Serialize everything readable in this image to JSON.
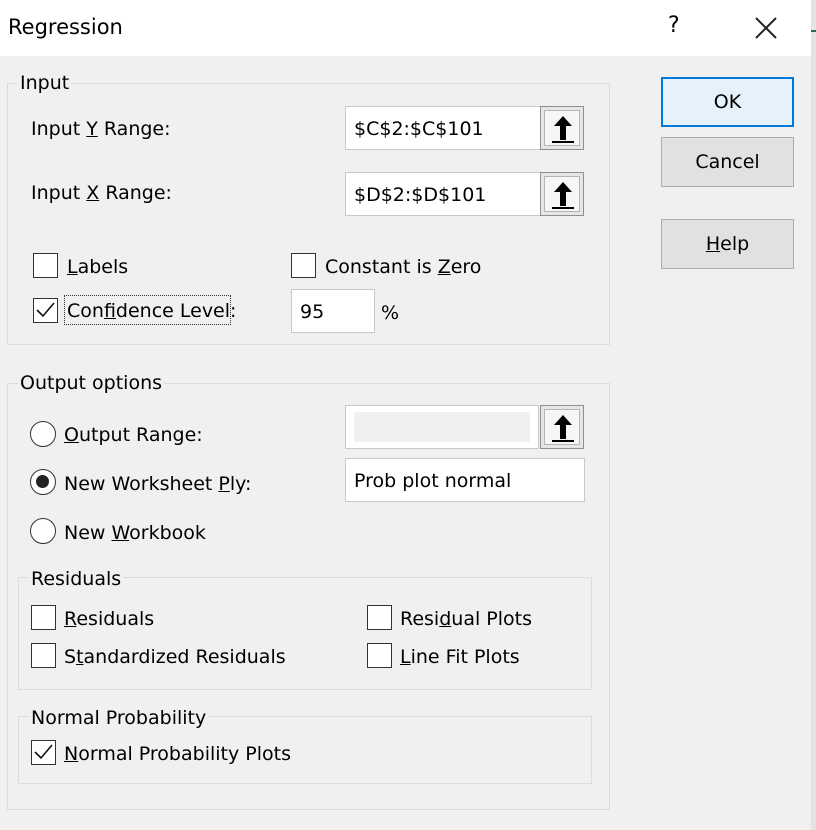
{
  "window": {
    "title": "Regression",
    "help_glyph": "?",
    "close_icon": "close-icon"
  },
  "input": {
    "group_label": "Input",
    "y_range": {
      "label_pre": "Input ",
      "label_key": "Y",
      "label_post": " Range:",
      "value": "$C$2:$C$101"
    },
    "x_range": {
      "label_pre": "Input ",
      "label_key": "X",
      "label_post": " Range:",
      "value": "$D$2:$D$101"
    },
    "labels": {
      "label_key": "L",
      "label_post": "abels",
      "checked": false
    },
    "constant_zero": {
      "label_pre": "Constant is ",
      "label_key": "Z",
      "label_post": "ero",
      "checked": false
    },
    "confidence": {
      "label_pre": "Con",
      "label_key": "f",
      "label_post": "idence Level:",
      "checked": true,
      "value": "95",
      "unit": "%"
    }
  },
  "output": {
    "group_label": "Output options",
    "output_range": {
      "label_key": "O",
      "label_post": "utput Range:",
      "selected": false,
      "value": ""
    },
    "new_ply": {
      "label_pre": "New Worksheet ",
      "label_key": "P",
      "label_post": "ly:",
      "selected": true,
      "value": "Prob plot normal"
    },
    "new_workbook": {
      "label_pre": "New ",
      "label_key": "W",
      "label_post": "orkbook",
      "selected": false
    }
  },
  "residuals": {
    "group_label": "Residuals",
    "residuals": {
      "label_key": "R",
      "label_post": "esiduals",
      "checked": false
    },
    "standardized": {
      "label_pre": "S",
      "label_key": "t",
      "label_post": "andardized Residuals",
      "checked": false
    },
    "residual_plots": {
      "label_pre": "Resi",
      "label_key": "d",
      "label_post": "ual Plots",
      "checked": false
    },
    "line_fit": {
      "label_key": "L",
      "label_post": "ine Fit Plots",
      "checked": false
    }
  },
  "normal_probability": {
    "group_label": "Normal Probability",
    "plots": {
      "label_key": "N",
      "label_post": "ormal Probability Plots",
      "checked": true
    }
  },
  "buttons": {
    "ok": "OK",
    "cancel": "Cancel",
    "help_key": "H",
    "help_post": "elp"
  },
  "icons": {
    "range_selector": "arrow-up-icon",
    "check": "checkmark-icon"
  }
}
